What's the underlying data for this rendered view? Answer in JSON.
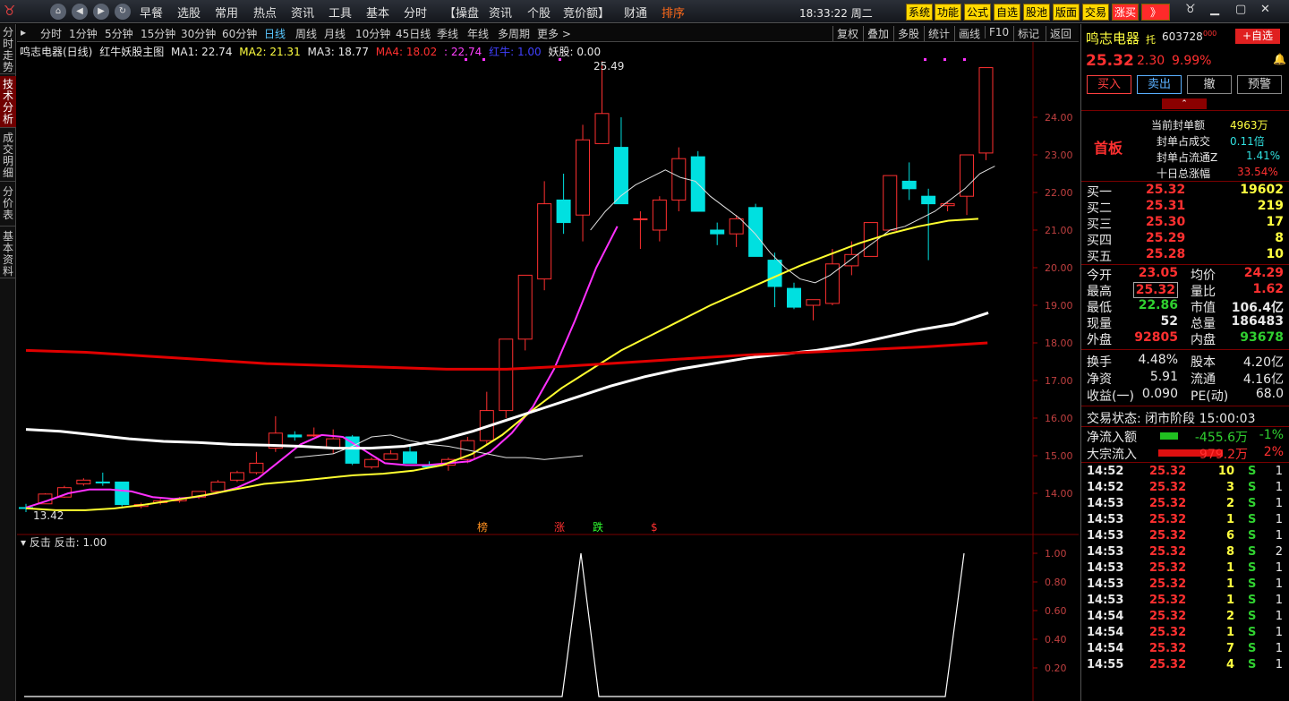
{
  "topbar": {
    "menus": [
      "早餐",
      "选股",
      "常用",
      "热点",
      "资讯",
      "工具",
      "基本",
      "分时",
      "【操盘",
      "资讯",
      "个股",
      "竞价额】",
      "财通",
      "排序"
    ],
    "clock": "18:33:22 周二",
    "buttons": [
      "系统",
      "功能",
      "公式",
      "自选",
      "股池",
      "版面",
      "交易",
      "涨买",
      "》"
    ]
  },
  "left_tabs": [
    "分时走势",
    "技术分析",
    "成交明细",
    "分价表",
    "基本资料"
  ],
  "period_bar": {
    "items": [
      "分时",
      "1分钟",
      "5分钟",
      "15分钟",
      "30分钟",
      "60分钟",
      "日线",
      "周线",
      "月线",
      "10分钟",
      "45日线",
      "季线",
      "年线",
      "多周期",
      "更多 >"
    ],
    "active": "日线",
    "right_items": [
      "复权",
      "叠加",
      "多股",
      "统计",
      "画线",
      "F10",
      "标记",
      "返回"
    ]
  },
  "chart_info": {
    "name": "鸣志电器(日线)",
    "indicator": "红牛妖股主图",
    "ma1": "MA1: 22.74",
    "ma2": "MA2: 21.31",
    "ma3": "MA3: 18.77",
    "ma4": "MA4: 18.02",
    "ma5": ": 22.74",
    "hn": "红牛: 1.00",
    "ys": "妖股: 0.00"
  },
  "chart_data": {
    "type": "candlestick",
    "candles": [
      [
        13.62,
        13.72,
        13.5,
        13.6
      ],
      [
        13.72,
        14.0,
        13.72,
        13.98
      ],
      [
        13.9,
        14.2,
        13.88,
        14.15
      ],
      [
        14.25,
        14.4,
        14.2,
        14.35
      ],
      [
        14.3,
        14.55,
        14.2,
        14.28
      ],
      [
        14.3,
        14.3,
        13.65,
        13.7
      ],
      [
        13.65,
        13.75,
        13.6,
        13.7
      ],
      [
        13.75,
        13.85,
        13.7,
        13.8
      ],
      [
        13.8,
        13.9,
        13.75,
        13.85
      ],
      [
        13.9,
        14.05,
        13.85,
        14.05
      ],
      [
        14.05,
        14.35,
        14.0,
        14.3
      ],
      [
        14.35,
        14.6,
        14.3,
        14.55
      ],
      [
        14.55,
        15.1,
        14.5,
        14.8
      ],
      [
        15.2,
        16.05,
        15.1,
        15.6
      ],
      [
        15.55,
        15.65,
        15.4,
        15.5
      ],
      [
        15.55,
        15.75,
        15.5,
        15.55
      ],
      [
        15.2,
        15.7,
        15.05,
        15.45
      ],
      [
        15.5,
        15.55,
        14.75,
        14.8
      ],
      [
        14.7,
        14.95,
        14.65,
        14.9
      ],
      [
        14.9,
        15.15,
        14.9,
        15.05
      ],
      [
        15.1,
        15.25,
        14.9,
        14.8
      ],
      [
        14.75,
        14.85,
        14.7,
        14.7
      ],
      [
        14.75,
        14.95,
        14.6,
        14.9
      ],
      [
        14.9,
        15.5,
        14.8,
        15.4
      ],
      [
        15.4,
        16.7,
        15.3,
        16.2
      ],
      [
        16.2,
        17.5,
        16.0,
        18.1
      ],
      [
        18.1,
        19.8,
        17.8,
        19.8
      ],
      [
        19.7,
        22.3,
        19.4,
        21.7
      ],
      [
        21.8,
        22.5,
        20.9,
        21.2
      ],
      [
        21.4,
        23.8,
        20.7,
        23.4
      ],
      [
        23.3,
        25.49,
        23.3,
        24.1
      ],
      [
        23.2,
        24.0,
        21.7,
        21.7
      ],
      [
        21.3,
        21.5,
        20.5,
        21.3
      ],
      [
        21.0,
        21.9,
        20.7,
        21.8
      ],
      [
        21.8,
        23.2,
        21.5,
        22.9
      ],
      [
        22.95,
        23.1,
        21.5,
        21.5
      ],
      [
        21.0,
        21.2,
        20.6,
        20.9
      ],
      [
        20.9,
        21.4,
        20.55,
        21.3
      ],
      [
        21.6,
        21.7,
        20.3,
        20.3
      ],
      [
        20.2,
        20.4,
        18.95,
        19.5
      ],
      [
        19.45,
        19.6,
        18.9,
        18.95
      ],
      [
        19.0,
        19.15,
        18.6,
        19.15
      ],
      [
        19.05,
        20.5,
        19.0,
        20.1
      ],
      [
        20.05,
        20.7,
        19.8,
        20.35
      ],
      [
        20.3,
        21.2,
        20.3,
        21.2
      ],
      [
        21.0,
        22.45,
        21.0,
        22.45
      ],
      [
        22.3,
        22.8,
        21.8,
        22.1
      ],
      [
        21.9,
        22.1,
        20.2,
        21.7
      ],
      [
        21.65,
        21.75,
        21.5,
        21.7
      ],
      [
        21.9,
        22.55,
        21.4,
        23.0
      ],
      [
        23.05,
        25.32,
        22.86,
        25.32
      ]
    ],
    "ma_white": [
      21.0,
      21.5,
      21.9,
      22.2,
      22.4,
      22.6,
      22.4,
      22.3,
      21.9,
      21.6,
      21.3,
      20.9,
      20.4,
      20.0,
      19.7,
      19.6,
      19.8,
      20.1,
      20.4,
      20.7,
      21.0,
      21.1,
      21.3,
      21.5,
      21.8,
      22.1,
      22.5,
      22.7
    ],
    "ma_magenta": [
      13.62,
      13.8,
      14.0,
      14.1,
      14.1,
      14.05,
      13.9,
      13.85,
      13.9,
      14.0,
      14.15,
      14.4,
      14.85,
      15.3,
      15.55,
      15.5,
      15.15,
      14.8,
      14.75,
      14.75,
      14.8,
      14.85,
      15.1,
      15.6,
      16.3,
      17.3,
      18.6,
      20.0,
      21.1
    ],
    "ma_yellow": [
      13.6,
      13.55,
      13.55,
      13.6,
      13.7,
      13.82,
      13.95,
      14.1,
      14.25,
      14.32,
      14.4,
      14.48,
      14.52,
      14.6,
      14.75,
      15.05,
      15.55,
      16.2,
      16.8,
      17.3,
      17.8,
      18.2,
      18.6,
      19.0,
      19.35,
      19.7,
      20.05,
      20.35,
      20.65,
      20.9,
      21.1,
      21.25,
      21.3
    ],
    "ma_white_slow": [
      15.7,
      15.65,
      15.55,
      15.45,
      15.38,
      15.35,
      15.3,
      15.28,
      15.25,
      15.2,
      15.2,
      15.25,
      15.4,
      15.65,
      15.95,
      16.25,
      16.55,
      16.85,
      17.1,
      17.3,
      17.45,
      17.6,
      17.7,
      17.8,
      17.95,
      18.15,
      18.35,
      18.5,
      18.8
    ],
    "ma_red": [
      17.8,
      17.75,
      17.65,
      17.55,
      17.45,
      17.4,
      17.35,
      17.3,
      17.3,
      17.38,
      17.48,
      17.58,
      17.68,
      17.75,
      17.82,
      17.9,
      18.0
    ],
    "y_ticks": [
      "24.00",
      "23.00",
      "22.00",
      "21.00",
      "20.00",
      "19.00",
      "18.00",
      "17.00",
      "16.00",
      "15.00",
      "14.00"
    ],
    "high_label": "25.49",
    "low_label": "13.42",
    "markers": [
      "榜",
      "涨",
      "跌",
      "$"
    ],
    "sub_title": "反击",
    "sub_value": "反击: 1.00",
    "sub_ticks": [
      "1.00",
      "0.80",
      "0.60",
      "0.40",
      "0.20"
    ]
  },
  "quote": {
    "name": "鸣志电器",
    "tag": "托",
    "code": "603728",
    "code_sup": "000",
    "add_button": "+自选",
    "price": "25.32",
    "change": "2.30",
    "pct": "9.99%",
    "trade_buttons": [
      "买入",
      "卖出",
      "撤",
      "预警"
    ],
    "board": "首板",
    "seal": [
      [
        "当前封单额",
        "4963万"
      ],
      [
        "封单占成交",
        "0.11倍"
      ],
      [
        "封单占流通Z",
        "1.41%"
      ],
      [
        "十日总涨幅",
        "33.54%"
      ]
    ],
    "bids": [
      [
        "买一",
        "25.32",
        "19602"
      ],
      [
        "买二",
        "25.31",
        "219"
      ],
      [
        "买三",
        "25.30",
        "17"
      ],
      [
        "买四",
        "25.29",
        "8"
      ],
      [
        "买五",
        "25.28",
        "10"
      ]
    ],
    "stats": [
      [
        "今开",
        "23.05",
        "均价",
        "24.29"
      ],
      [
        "最高",
        "25.32",
        "量比",
        "1.62"
      ],
      [
        "最低",
        "22.86",
        "市值",
        "106.4亿"
      ],
      [
        "现量",
        "52",
        "总量",
        "186483"
      ],
      [
        "外盘",
        "92805",
        "内盘",
        "93678"
      ]
    ],
    "stats2": [
      [
        "换手",
        "4.48%",
        "股本",
        "4.20亿"
      ],
      [
        "净资",
        "5.91",
        "流通",
        "4.16亿"
      ],
      [
        "收益(一)",
        "0.090",
        "PE(动)",
        "68.0"
      ]
    ],
    "trade_status": "交易状态: 闭市阶段 15:00:03",
    "flows": [
      [
        "净流入额",
        "-455.6万",
        "-1%"
      ],
      [
        "大宗流入",
        "979.2万",
        "2%"
      ]
    ],
    "ticks": [
      [
        "14:52",
        "25.32",
        "10",
        "S",
        "1"
      ],
      [
        "14:52",
        "25.32",
        "3",
        "S",
        "1"
      ],
      [
        "14:53",
        "25.32",
        "2",
        "S",
        "1"
      ],
      [
        "14:53",
        "25.32",
        "1",
        "S",
        "1"
      ],
      [
        "14:53",
        "25.32",
        "6",
        "S",
        "1"
      ],
      [
        "14:53",
        "25.32",
        "8",
        "S",
        "2"
      ],
      [
        "14:53",
        "25.32",
        "1",
        "S",
        "1"
      ],
      [
        "14:53",
        "25.32",
        "1",
        "S",
        "1"
      ],
      [
        "14:53",
        "25.32",
        "1",
        "S",
        "1"
      ],
      [
        "14:54",
        "25.32",
        "2",
        "S",
        "1"
      ],
      [
        "14:54",
        "25.32",
        "1",
        "S",
        "1"
      ],
      [
        "14:54",
        "25.32",
        "7",
        "S",
        "1"
      ],
      [
        "14:55",
        "25.32",
        "4",
        "S",
        "1"
      ]
    ]
  }
}
